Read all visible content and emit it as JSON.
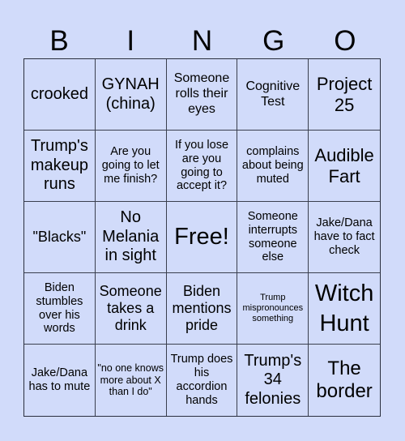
{
  "header": {
    "letters": [
      "B",
      "I",
      "N",
      "G",
      "O"
    ]
  },
  "colors": {
    "background": "#d1dbfa",
    "border": "#3a3f4e",
    "text": "#000000"
  },
  "cells": [
    "crooked",
    "GYNAH (china)",
    "Someone rolls their eyes",
    "Cognitive Test",
    "Project 25",
    "Trump's makeup runs",
    "Are you going to let me finish?",
    "If you lose are you going to accept it?",
    "complains about being muted",
    "Audible Fart",
    "\"Blacks\"",
    "No Melania in sight",
    "Free!",
    "Someone interrupts someone else",
    "Jake/Dana have to fact check",
    "Biden stumbles over his words",
    "Someone takes a drink",
    "Biden mentions pride",
    "Trump mispronounces something",
    "Witch Hunt",
    "Jake/Dana has to mute",
    "\"no one knows more about X than I do\"",
    "Trump does his accordion hands",
    "Trump's 34 felonies",
    "The border"
  ]
}
